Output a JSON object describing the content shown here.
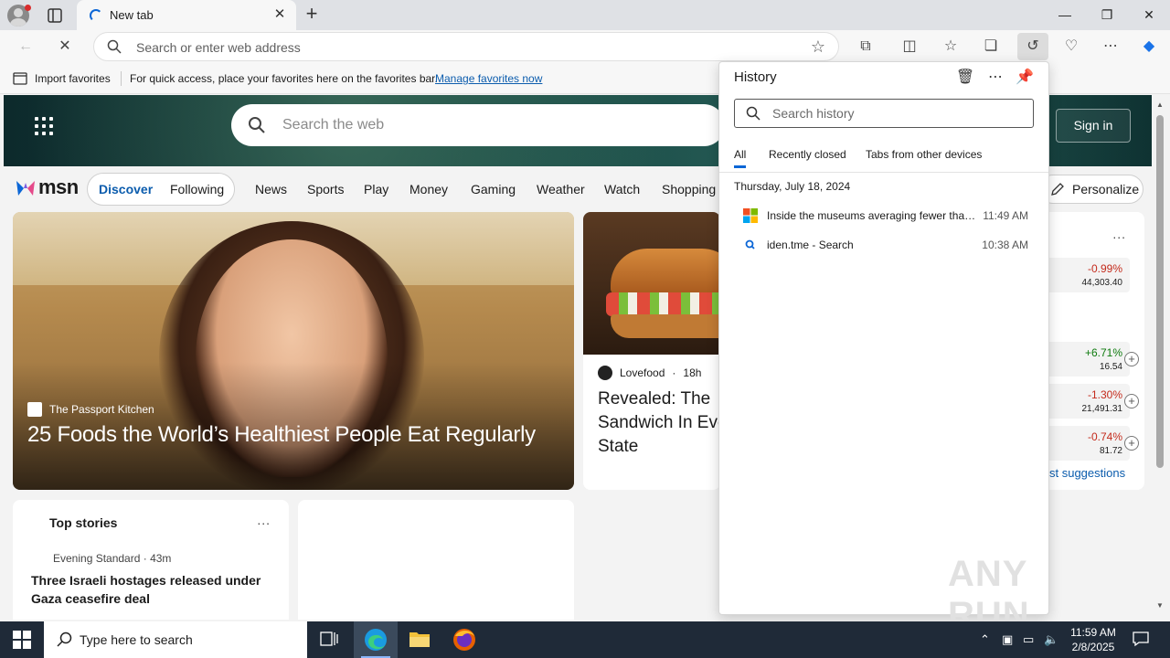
{
  "browser": {
    "tab_title": "New tab",
    "address_placeholder": "Search or enter web address"
  },
  "favorites_bar": {
    "import_label": "Import favorites",
    "message": "For quick access, place your favorites here on the favorites bar.",
    "manage_link": "Manage favorites now"
  },
  "msn": {
    "search_placeholder": "Search the web",
    "sign_in": "Sign in",
    "logo_text": "msn",
    "discover": "Discover",
    "following": "Following",
    "nav": [
      "News",
      "Sports",
      "Play",
      "Money",
      "Gaming",
      "Weather",
      "Watch",
      "Shopping"
    ],
    "personalize": "Personalize",
    "hero": {
      "source": "The Passport Kitchen",
      "title": "25 Foods the World’s Healthiest People Eat Regularly"
    },
    "card2": {
      "source": "Lovefood",
      "age": "18h",
      "title": "Revealed: The Sandwich In Every State"
    },
    "top_stories": {
      "title": "Top stories",
      "more": "...",
      "source": "Evening Standard · 43m",
      "headline": "Three Israeli hostages released under Gaza ceasefire deal"
    },
    "widget": {
      "more": "...",
      "rows": [
        {
          "pct": "-0.99%",
          "val": "44,303.40",
          "trend": "neg"
        },
        {
          "pct": "+6.71%",
          "val": "16.54",
          "trend": "pos"
        },
        {
          "pct": "-1.30%",
          "val": "21,491.31",
          "trend": "neg"
        },
        {
          "pct": "-0.74%",
          "val": "81.72",
          "trend": "neg"
        }
      ],
      "link": "st suggestions"
    }
  },
  "history": {
    "title": "History",
    "search_placeholder": "Search history",
    "tabs": [
      "All",
      "Recently closed",
      "Tabs from other devices"
    ],
    "date": "Thursday, July 18, 2024",
    "items": [
      {
        "title": "Inside the museums averaging fewer than ...",
        "time": "11:49 AM",
        "icon": "microsoft-icon"
      },
      {
        "title": "iden.tme - Search",
        "time": "10:38 AM",
        "icon": "search-icon"
      }
    ],
    "watermark": "ANY RUN"
  },
  "taskbar": {
    "search_placeholder": "Type here to search",
    "time": "11:59 AM",
    "date": "2/8/2025"
  },
  "colors": {
    "accent": "#0b66d6",
    "link": "#0b5cad",
    "negative": "#c42b1c",
    "positive": "#0f7b0f",
    "taskbar": "#1f2a38"
  }
}
